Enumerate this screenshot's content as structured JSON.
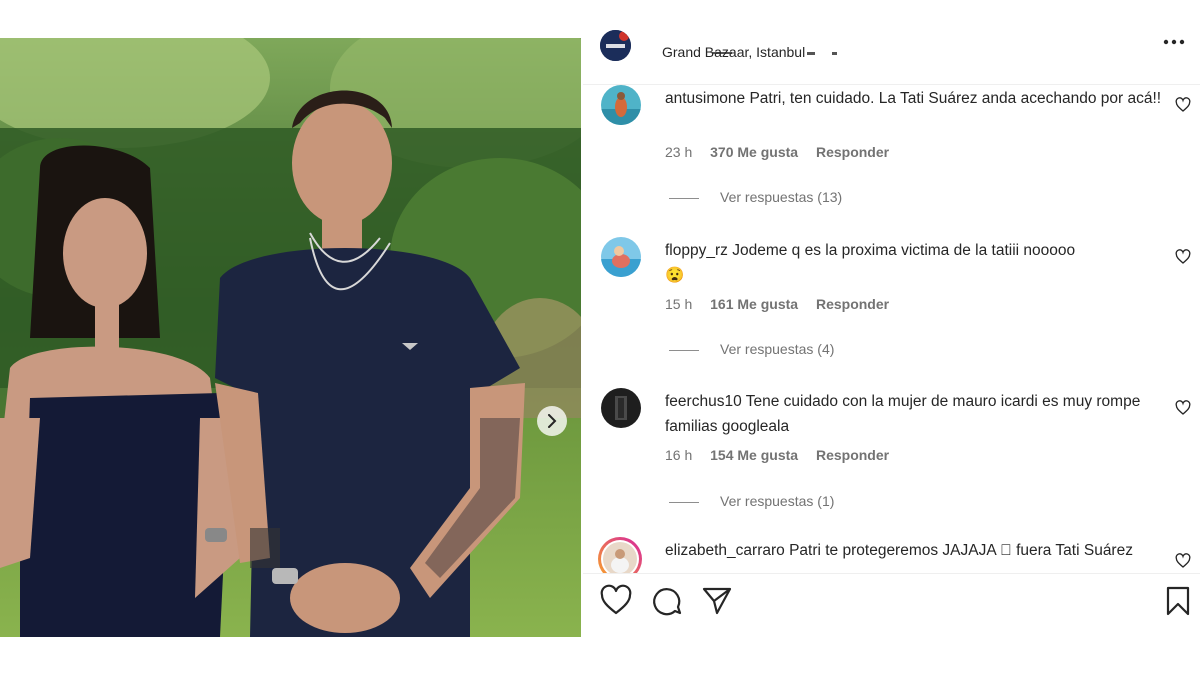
{
  "post": {
    "location": "Grand Bazaar, Istanbul"
  },
  "icons": {
    "more": "more-horizontal-icon",
    "next": "chevron-right-icon",
    "like": "heart-icon",
    "comment": "comment-icon",
    "share": "paper-plane-icon",
    "save": "bookmark-icon"
  },
  "comments": [
    {
      "username": "antusimone",
      "text": "Patri, ten cuidado. La Tati Suárez anda acechando por acá!!",
      "time": "23 h",
      "likes": "370 Me gusta",
      "reply": "Responder",
      "view_replies": "Ver respuestas (13)"
    },
    {
      "username": "floppy_rz",
      "text": "Jodeme q es la proxima victima de la tatiii nooooo",
      "emoji": "😧",
      "time": "15 h",
      "likes": "161 Me gusta",
      "reply": "Responder",
      "view_replies": "Ver respuestas (4)"
    },
    {
      "username": "feerchus10",
      "text": "Tene cuidado con la mujer de mauro icardi es muy rompe familias googleala",
      "time": "16 h",
      "likes": "154 Me gusta",
      "reply": "Responder",
      "view_replies": "Ver respuestas (1)"
    },
    {
      "username": "elizabeth_carraro",
      "text": "Patri te protegeremos JAJAJA 􏿽 fuera Tati Suárez"
    }
  ],
  "colors": {
    "text": "#262626",
    "secondary": "#737373",
    "divider": "#efefef",
    "story_ring_start": "#f9a825",
    "story_ring_end": "#d6249f"
  }
}
